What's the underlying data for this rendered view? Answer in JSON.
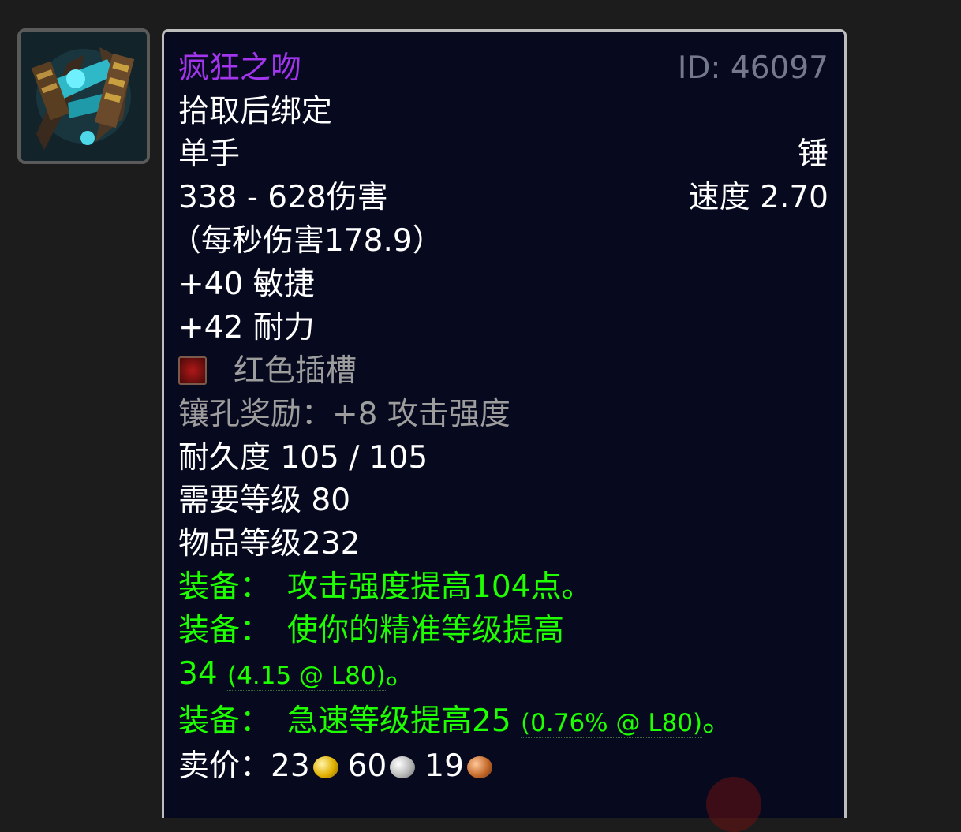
{
  "item": {
    "icon_name": "mace-icon",
    "name": "疯狂之吻",
    "id_label": "ID: 46097",
    "bind": "拾取后绑定",
    "slot": "单手",
    "type": "锤",
    "damage": "338 - 628伤害",
    "speed": "速度 2.70",
    "dps": "（每秒伤害178.9）",
    "stat_agility": "+40 敏捷",
    "stat_stamina": "+42 耐力",
    "socket": "红色插槽",
    "socket_bonus": "镶孔奖励：+8 攻击强度",
    "durability": "耐久度 105 / 105",
    "required_level": "需要等级 80",
    "item_level": "物品等级232",
    "equip_label": "装备：",
    "equip_1": "攻击强度提高104点。",
    "equip_2": "使你的精准等级提高",
    "equip_2_value": "34",
    "equip_2_rating": "(4.15 @ L80)",
    "equip_3": "急速等级提高25",
    "equip_3_rating": "(0.76% @ L80)",
    "period": "。",
    "sell_label": "卖价：",
    "gold": "23",
    "silver": "60",
    "copper": "19"
  },
  "colors": {
    "epic": "#a335ee",
    "green": "#1eff00",
    "gray": "#9d9d9d",
    "background": "#070a1f"
  }
}
